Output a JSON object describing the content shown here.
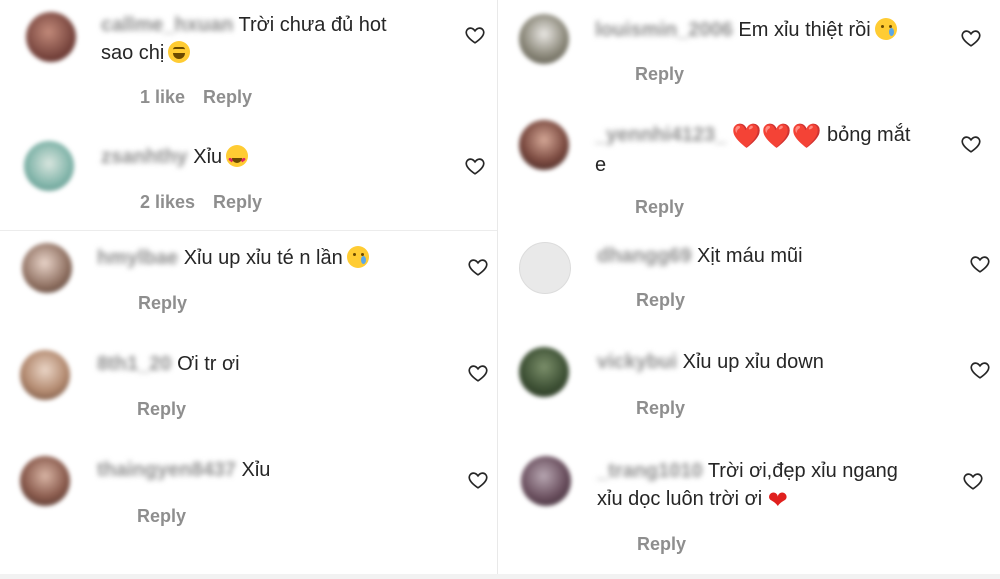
{
  "colors": {
    "username": "#8e8e8e",
    "text": "#262626",
    "meta": "#8e8e8e",
    "heart_red": "#e0201e"
  },
  "icons": {
    "like": "heart-outline-icon"
  },
  "left": [
    {
      "username": "callme_hxuan",
      "text": "Trời chưa đủ hot",
      "text2": "sao chị",
      "emoji": "laugh",
      "likes": "1 like",
      "reply": "Reply"
    },
    {
      "username": "zsanhthy",
      "text": "Xỉu",
      "emoji": "hearteyes",
      "likes": "2 likes",
      "reply": "Reply"
    },
    {
      "username": "hmylbae",
      "text": "Xỉu up xỉu té n lần",
      "emoji": "cry",
      "reply": "Reply"
    },
    {
      "username": "8th1_20",
      "text": "Ơi tr ơi",
      "reply": "Reply"
    },
    {
      "username": "thaingyen8437",
      "text": "Xỉu",
      "reply": "Reply"
    }
  ],
  "right": [
    {
      "username": "louismin_2006",
      "text": "Em xỉu thiệt rồi",
      "emoji": "cry",
      "reply": "Reply"
    },
    {
      "username": "_yennhi4123_",
      "hearts": "❤️❤️❤️",
      "text": "bỏng mắt",
      "text2": "e",
      "reply": "Reply"
    },
    {
      "username": "dhangg69",
      "text": "Xịt máu mũi",
      "reply": "Reply"
    },
    {
      "username": "vickybui",
      "text": "Xỉu up xỉu down",
      "reply": "Reply"
    },
    {
      "username": "_trang1010",
      "text": "Trời ơi,đẹp xỉu ngang",
      "text2": "xỉu dọc luôn trời ơi",
      "hearts": "❤",
      "reply": "Reply"
    }
  ]
}
